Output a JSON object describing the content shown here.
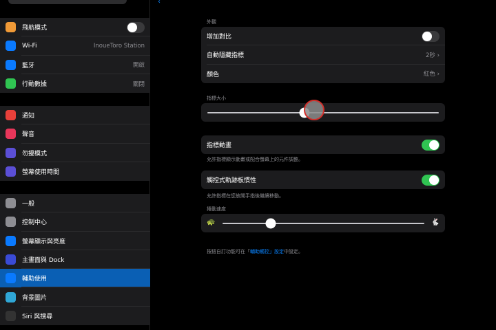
{
  "sidebar": {
    "group1": [
      {
        "label": "飛航模式",
        "icon": "airplane-icon",
        "color": "#f09a37",
        "toggle": false
      },
      {
        "label": "Wi-Fi",
        "icon": "wifi-icon",
        "color": "#0a7aff",
        "value": "InoueToro Station"
      },
      {
        "label": "藍牙",
        "icon": "bluetooth-icon",
        "color": "#0a7aff",
        "value": "開啟"
      },
      {
        "label": "行動數據",
        "icon": "cellular-icon",
        "color": "#30c452",
        "value": "關閉"
      }
    ],
    "group2": [
      {
        "label": "通知",
        "icon": "notifications-icon",
        "color": "#e8403a"
      },
      {
        "label": "聲音",
        "icon": "sound-icon",
        "color": "#e8365a"
      },
      {
        "label": "勿擾模式",
        "icon": "moon-icon",
        "color": "#5b4fd6"
      },
      {
        "label": "螢幕使用時間",
        "icon": "hourglass-icon",
        "color": "#5b4fd6"
      }
    ],
    "group3": [
      {
        "label": "一般",
        "icon": "gear-icon",
        "color": "#8e8e93"
      },
      {
        "label": "控制中心",
        "icon": "control-center-icon",
        "color": "#8e8e93"
      },
      {
        "label": "螢幕顯示與亮度",
        "icon": "display-icon",
        "color": "#0a7aff"
      },
      {
        "label": "主畫面與 Dock",
        "icon": "home-screen-icon",
        "color": "#3a4bd6"
      },
      {
        "label": "輔助使用",
        "icon": "accessibility-icon",
        "color": "#0a7aff",
        "selected": true
      },
      {
        "label": "背景圖片",
        "icon": "wallpaper-icon",
        "color": "#30a7d6"
      },
      {
        "label": "Siri 與搜尋",
        "icon": "siri-icon",
        "color": "#333"
      }
    ]
  },
  "main": {
    "appearance_label": "外觀",
    "increase_contrast": {
      "label": "增加對比",
      "on": false
    },
    "auto_hide": {
      "label": "自動隱藏指標",
      "value": "2秒"
    },
    "color": {
      "label": "顏色",
      "value": "紅色"
    },
    "pointer_size_label": "指標大小",
    "pointer_size_value": 0.42,
    "pointer_animation": {
      "label": "指標動畫",
      "on": true,
      "footnote": "允許指標顯示動畫或配合螢幕上的元件調整。"
    },
    "trackpad_inertia": {
      "label": "觸控式軌跡板慣性",
      "on": true,
      "footnote": "允許指標在您放開手指後繼續移動。"
    },
    "scroll_speed_label": "捲動速度",
    "scroll_speed_value": 0.24,
    "footer": {
      "pre": "按鈕自訂功能可在「",
      "link": "輔助觸控」設定",
      "post": "中設定。"
    }
  }
}
